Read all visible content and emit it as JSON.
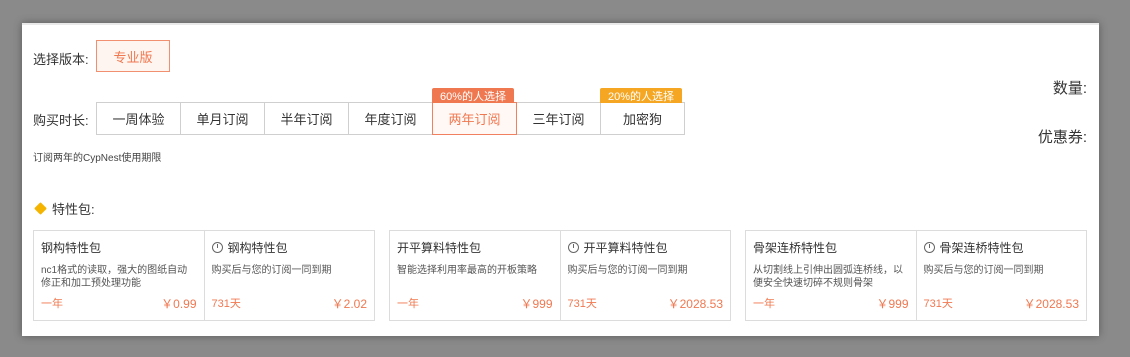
{
  "version": {
    "label": "选择版本:",
    "selected": "专业版"
  },
  "duration": {
    "label": "购买时长:",
    "options": [
      {
        "label": "一周体验",
        "badge": ""
      },
      {
        "label": "单月订阅",
        "badge": ""
      },
      {
        "label": "半年订阅",
        "badge": ""
      },
      {
        "label": "年度订阅",
        "badge": ""
      },
      {
        "label": "两年订阅",
        "badge": "60%的人选择",
        "badge_color": "#f07850",
        "selected": true
      },
      {
        "label": "三年订阅",
        "badge": ""
      },
      {
        "label": "加密狗",
        "badge": "20%的人选择",
        "badge_color": "#f5a623"
      }
    ],
    "note": "订阅两年的CypNest使用期限"
  },
  "right": {
    "quantity_label": "数量:",
    "coupon_label": "优惠券:"
  },
  "features": {
    "title": "特性包:",
    "groups": [
      {
        "left": {
          "title": "钢构特性包",
          "desc": "nc1格式的读取，强大的图纸自动修正和加工预处理功能",
          "period": "一年",
          "price": "￥0.99"
        },
        "right": {
          "title": "钢构特性包",
          "desc": "购买后与您的订阅一同到期",
          "period": "731天",
          "price": "￥2.02"
        }
      },
      {
        "left": {
          "title": "开平算料特性包",
          "desc": "智能选择利用率最高的开板策略",
          "period": "一年",
          "price": "￥999"
        },
        "right": {
          "title": "开平算料特性包",
          "desc": "购买后与您的订阅一同到期",
          "period": "731天",
          "price": "￥2028.53"
        }
      },
      {
        "left": {
          "title": "骨架连桥特性包",
          "desc": "从切割线上引伸出圆弧连桥线，以便安全快速切碎不规则骨架",
          "period": "一年",
          "price": "￥999"
        },
        "right": {
          "title": "骨架连桥特性包",
          "desc": "购买后与您的订阅一同到期",
          "period": "731天",
          "price": "￥2028.53"
        }
      }
    ]
  },
  "colors": {
    "accent": "#f07850",
    "badge_orange": "#f5a623",
    "feature_icon": "#f5b400"
  },
  "icons": {
    "feature_header": "diamond-icon",
    "card_right": "clock-icon"
  }
}
